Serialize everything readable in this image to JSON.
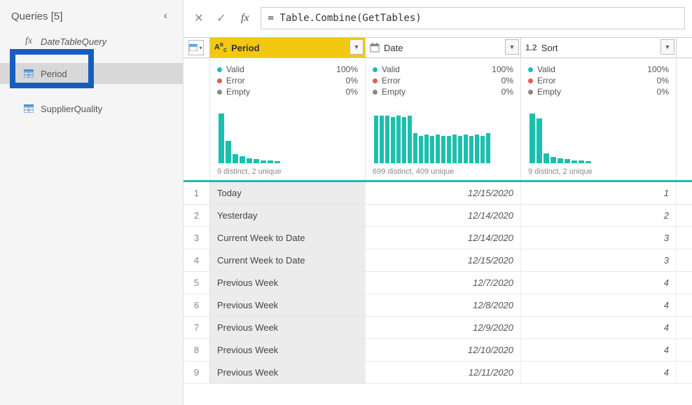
{
  "sidebar": {
    "title": "Queries [5]",
    "items": [
      {
        "label": "DateTableQuery",
        "type": "fx"
      },
      {
        "label": "Period",
        "type": "table",
        "selected": true
      },
      {
        "label": "SupplierQuality",
        "type": "table"
      }
    ]
  },
  "formula": {
    "value": "= Table.Combine(GetTables)"
  },
  "columns": [
    {
      "name": "Period",
      "type_label": "ABC",
      "type": "text",
      "selected": true
    },
    {
      "name": "Date",
      "type_label": "cal",
      "type": "date"
    },
    {
      "name": "Sort",
      "type_label": "1.2",
      "type": "number"
    }
  ],
  "profiles": [
    {
      "valid": "100%",
      "error": "0%",
      "empty": "0%",
      "distinct": "9 distinct, 2 unique",
      "bars": [
        100,
        45,
        18,
        14,
        10,
        8,
        6,
        5,
        4
      ]
    },
    {
      "valid": "100%",
      "error": "0%",
      "empty": "0%",
      "distinct": "699 distinct, 409 unique",
      "bars": [
        95,
        95,
        95,
        92,
        95,
        92,
        95,
        60,
        55,
        58,
        55,
        58,
        55,
        55,
        58,
        55,
        58,
        55,
        58,
        55,
        60
      ]
    },
    {
      "valid": "100%",
      "error": "0%",
      "empty": "0%",
      "distinct": "9 distinct, 2 unique",
      "bars": [
        100,
        90,
        20,
        12,
        10,
        8,
        6,
        5,
        4
      ]
    }
  ],
  "rows": [
    {
      "n": "1",
      "period": "Today",
      "date": "12/15/2020",
      "sort": "1"
    },
    {
      "n": "2",
      "period": "Yesterday",
      "date": "12/14/2020",
      "sort": "2"
    },
    {
      "n": "3",
      "period": "Current Week to Date",
      "date": "12/14/2020",
      "sort": "3"
    },
    {
      "n": "4",
      "period": "Current Week to Date",
      "date": "12/15/2020",
      "sort": "3"
    },
    {
      "n": "5",
      "period": "Previous Week",
      "date": "12/7/2020",
      "sort": "4"
    },
    {
      "n": "6",
      "period": "Previous Week",
      "date": "12/8/2020",
      "sort": "4"
    },
    {
      "n": "7",
      "period": "Previous Week",
      "date": "12/9/2020",
      "sort": "4"
    },
    {
      "n": "8",
      "period": "Previous Week",
      "date": "12/10/2020",
      "sort": "4"
    },
    {
      "n": "9",
      "period": "Previous Week",
      "date": "12/11/2020",
      "sort": "4"
    }
  ],
  "labels": {
    "valid": "Valid",
    "error": "Error",
    "empty": "Empty"
  }
}
